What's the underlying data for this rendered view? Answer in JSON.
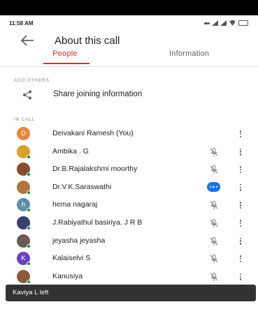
{
  "status_bar": {
    "time": "11:58 AM"
  },
  "header": {
    "title": "About this call"
  },
  "tabs": {
    "people": "People",
    "information": "Information"
  },
  "sections": {
    "add_others": "ADD OTHERS",
    "share_label": "Share joining information",
    "in_call": "IN CALL"
  },
  "participants": [
    {
      "name": "Deivakani Ramesh (You)",
      "initial": "D",
      "avatar_color": "#e8853d",
      "status_icon": ""
    },
    {
      "name": "Ambika . G",
      "initial": "",
      "avatar_color": "#d9a02b",
      "status_icon": "mic-off-icon"
    },
    {
      "name": "Dr.B.Rajalakshmi moorthy",
      "initial": "",
      "avatar_color": "#8a4b2e",
      "status_icon": "mic-off-icon"
    },
    {
      "name": "Dr.V.K.Saraswathi",
      "initial": "",
      "avatar_color": "#b0743c",
      "status_icon": "speaking-icon"
    },
    {
      "name": "hema nagaraj",
      "initial": "h",
      "avatar_color": "#5f8fa8",
      "status_icon": "mic-off-icon"
    },
    {
      "name": "J.Rabiyathul basiriya. J R B",
      "initial": "",
      "avatar_color": "#3b3f6e",
      "status_icon": "mic-off-icon"
    },
    {
      "name": "jeyasha jeyasha",
      "initial": "",
      "avatar_color": "#6b5a55",
      "status_icon": "mic-off-icon"
    },
    {
      "name": "Kalaiselvi S",
      "initial": "K",
      "avatar_color": "#6a3fc2",
      "status_icon": "mic-off-icon"
    },
    {
      "name": "Kanusiya",
      "initial": "",
      "avatar_color": "#8c5a3c",
      "status_icon": "mic-off-icon"
    }
  ],
  "toast": {
    "message": "Kaviya L left"
  },
  "colors": {
    "accent": "#d93025",
    "speaking": "#1a73e8",
    "online": "#1e8e3e"
  }
}
